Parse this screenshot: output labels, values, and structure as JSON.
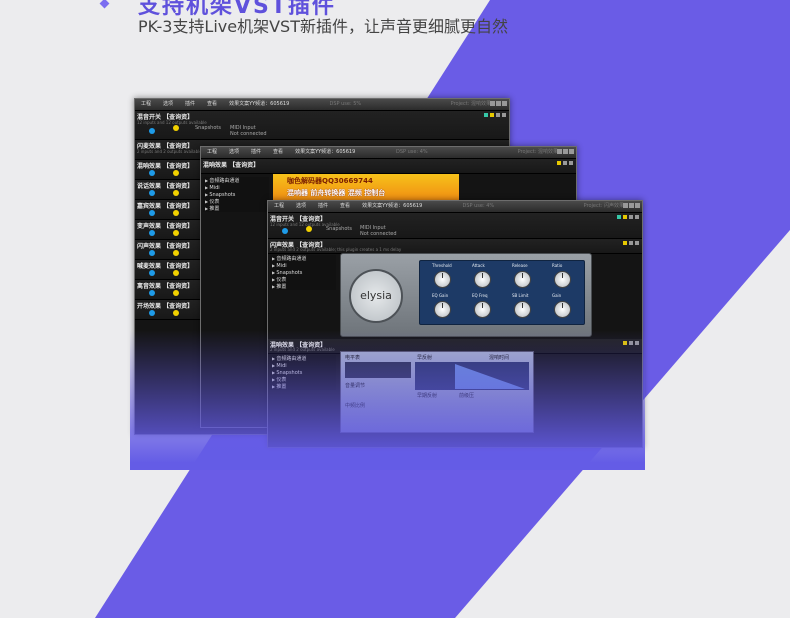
{
  "header": {
    "title": "支持机架VST插件",
    "subtitle": "PK-3支持Live机架VST新插件，让声音更细腻更自然"
  },
  "colors": {
    "accent": "#6a5ce6",
    "background": "#ececee"
  },
  "window_back": {
    "menu": [
      "工程",
      "选项",
      "插件",
      "查看",
      "效果文案YY频道：605619"
    ],
    "dsp": "DSP use: 5%",
    "project": "Project: 混响效果",
    "tracks": [
      {
        "name": "混音开关 【查询资】",
        "info": "12 inputs and 12 outputs available",
        "detail1": "MIDI Input",
        "detail2": "Not connected",
        "snap": "Snapshots"
      },
      {
        "name": "闪麦效果 【查询资】",
        "info": "2 inputs and 2 outputs available"
      },
      {
        "name": "混响效果 【查询资】",
        "info": "2 inputs and 2 outputs available"
      },
      {
        "name": "说话效果 【查询资】",
        "info": "2 inputs and 2 outputs available"
      },
      {
        "name": "嘉宾效果 【查询资】",
        "info": "2 inputs and 2 outputs available"
      },
      {
        "name": "变声效果 【查询资】",
        "info": "2 inputs and 2 outputs available"
      },
      {
        "name": "闪声效果 【查询资】",
        "info": "2 inputs and 2 outputs available"
      },
      {
        "name": "喊麦效果 【查询资】",
        "info": "2 inputs and 2 outputs available"
      },
      {
        "name": "离音效果 【查询资】",
        "info": "2 inputs and 2 outputs available"
      },
      {
        "name": "开场效果 【查询资】",
        "info": "2 inputs and 2 outputs available"
      }
    ]
  },
  "window_mid": {
    "menu": [
      "工程",
      "选项",
      "插件",
      "查看",
      "效果文案YY频道：605619"
    ],
    "dsp": "DSP use: 4%",
    "project": "Project: 混响效果",
    "track": "混响效果 【查询资】",
    "sidebar": [
      "音频路由通道",
      "Midi",
      "Snapshots",
      "仪表",
      "推置"
    ],
    "ad_line1": "咖色解码器QQ30669744",
    "ad_line2": "混响器  前舟转换器  混频  控制台"
  },
  "window_front": {
    "menu": [
      "工程",
      "选项",
      "插件",
      "查看",
      "效果文案YY频道：605619"
    ],
    "dsp": "DSP use: 4%",
    "project": "Project: 闪声效果",
    "track1": {
      "name": "混音开关 【查询资】",
      "info": "12 inputs and 12 outputs available",
      "detail1": "MIDI Input",
      "detail2": "Not connected",
      "snap": "Snapshots"
    },
    "track2": {
      "name": "闪声效果 【查询资】",
      "info": "2 inputs and 2 outputs available; this plugin creates a 1 ms delay"
    },
    "sidebar": [
      "音频路由通道",
      "Midi",
      "Snapshots",
      "仪表",
      "推置"
    ],
    "plugin_brand": "elysia",
    "knob_labels_top": [
      "Threshold",
      "Attack",
      "Release",
      "Ratio"
    ],
    "knob_labels_bottom": [
      "EQ Gain",
      "EQ Freq",
      "SB Limit",
      "Gain"
    ],
    "track3": {
      "name": "混响效果 【查询资】",
      "info": "2 inputs and 2 outputs available"
    },
    "sidebar2": [
      "音频路由通道",
      "Midi",
      "Snapshots",
      "仪表",
      "推置"
    ],
    "graph_labels": [
      "电平表",
      "早反射",
      "混响时间",
      "音量调节",
      "早期反射",
      "前级压",
      "中频比例"
    ]
  }
}
